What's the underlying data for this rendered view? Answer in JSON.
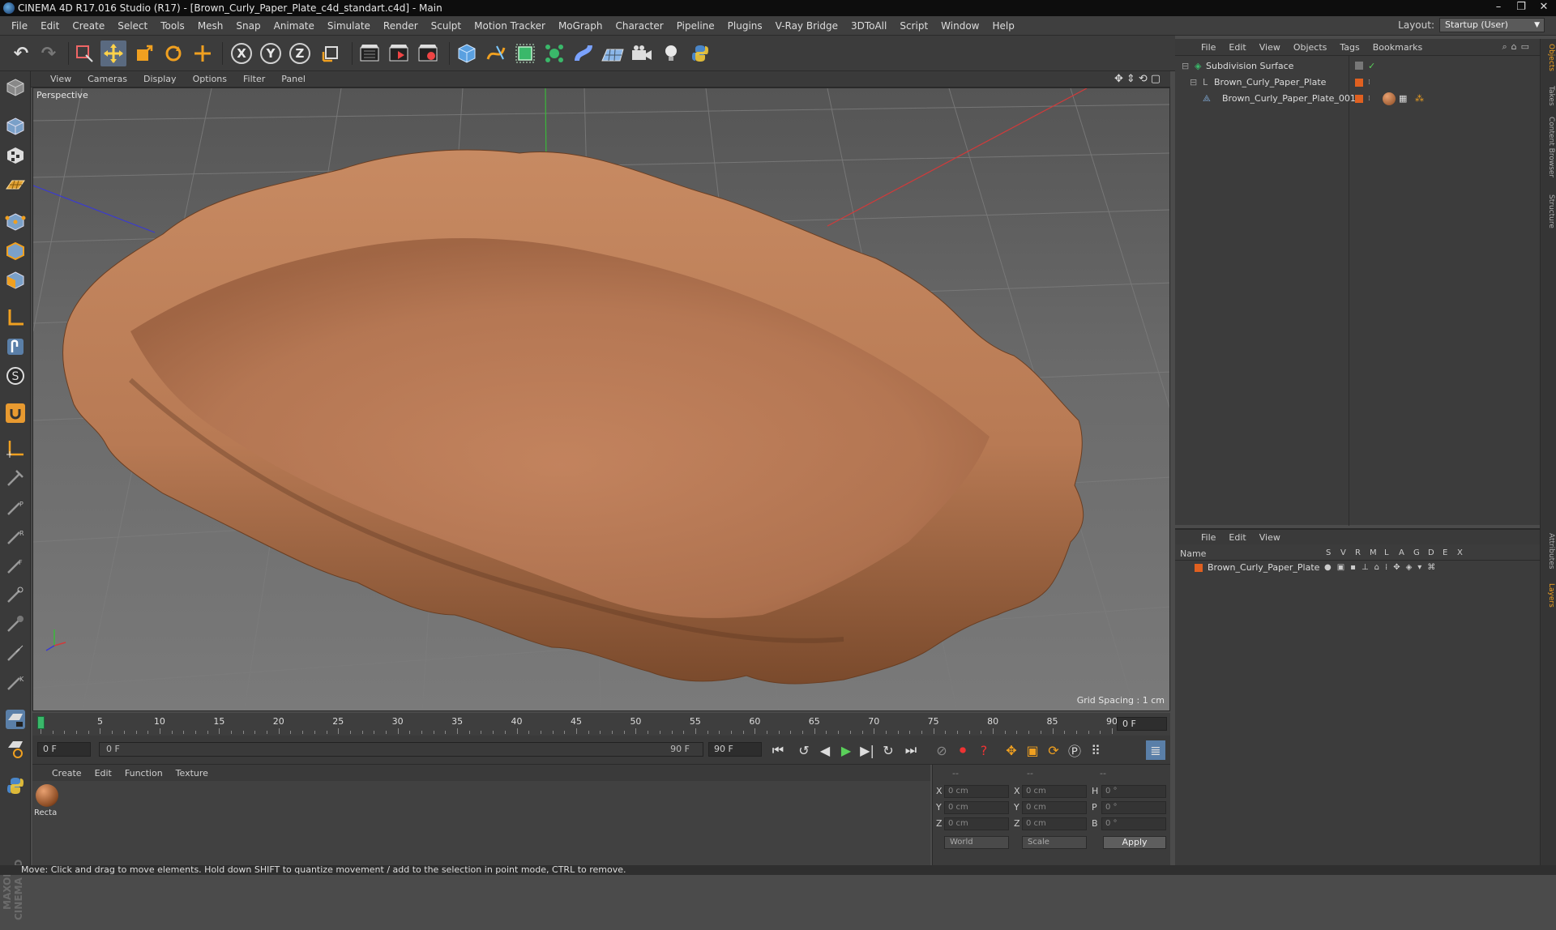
{
  "window": {
    "title": "CINEMA 4D R17.016 Studio (R17) - [Brown_Curly_Paper_Plate_c4d_standart.c4d] - Main",
    "controls": [
      "–",
      "❐",
      "✕"
    ]
  },
  "menubar": {
    "items": [
      "File",
      "Edit",
      "Create",
      "Select",
      "Tools",
      "Mesh",
      "Snap",
      "Animate",
      "Simulate",
      "Render",
      "Sculpt",
      "Motion Tracker",
      "MoGraph",
      "Character",
      "Pipeline",
      "Plugins",
      "V-Ray Bridge",
      "3DToAll",
      "Script",
      "Window",
      "Help"
    ],
    "layout_label": "Layout:",
    "layout_value": "Startup (User)"
  },
  "toolbar": {
    "axis_x": "X",
    "axis_y": "Y",
    "axis_z": "Z"
  },
  "viewport": {
    "menu": [
      "View",
      "Cameras",
      "Display",
      "Options",
      "Filter",
      "Panel"
    ],
    "camera_label": "Perspective",
    "grid_spacing": "Grid Spacing : 1 cm",
    "colors": {
      "x_axis": "#d23a3a",
      "y_axis": "#3ab83a",
      "z_axis": "#3a3ad2",
      "plate": "#c68a62"
    }
  },
  "timeline": {
    "ticks": [
      "0",
      "5",
      "10",
      "15",
      "20",
      "25",
      "30",
      "35",
      "40",
      "45",
      "50",
      "55",
      "60",
      "65",
      "70",
      "75",
      "80",
      "85",
      "90"
    ],
    "current_frame": "0 F"
  },
  "transport": {
    "start_frame": "0 F",
    "range_start": "0 F",
    "range_end": "90 F",
    "end_frame": "90 F"
  },
  "material_manager": {
    "menu": [
      "Create",
      "Edit",
      "Function",
      "Texture"
    ],
    "material_name": "Recta"
  },
  "coordinates": {
    "headers": [
      "--",
      "--",
      "--"
    ],
    "pos_labels": [
      "X",
      "Y",
      "Z"
    ],
    "size_labels": [
      "X",
      "Y",
      "Z"
    ],
    "rot_labels": [
      "H",
      "P",
      "B"
    ],
    "pos_values": [
      "0 cm",
      "0 cm",
      "0 cm"
    ],
    "size_values": [
      "0 cm",
      "0 cm",
      "0 cm"
    ],
    "rot_values": [
      "0 °",
      "0 °",
      "0 °"
    ],
    "space_mode": "World",
    "size_mode": "Scale",
    "apply_label": "Apply"
  },
  "objects_panel": {
    "menu": [
      "File",
      "Edit",
      "View",
      "Objects",
      "Tags",
      "Bookmarks"
    ],
    "rows": [
      {
        "name": "Subdivision Surface"
      },
      {
        "name": "Brown_Curly_Paper_Plate"
      },
      {
        "name": "Brown_Curly_Paper_Plate_001"
      }
    ]
  },
  "layers_panel": {
    "menu": [
      "File",
      "Edit",
      "View"
    ],
    "name_header": "Name",
    "column_headers": [
      "S",
      "V",
      "R",
      "M",
      "L",
      "A",
      "G",
      "D",
      "E",
      "X"
    ],
    "rows": [
      {
        "name": "Brown_Curly_Paper_Plate"
      }
    ]
  },
  "side_tabs": [
    "Objects",
    "Takes",
    "Content Browser",
    "Structure",
    "Attributes",
    "Layers"
  ],
  "status": {
    "text": "Move: Click and drag to move elements. Hold down SHIFT to quantize movement / add to the selection in point mode, CTRL to remove."
  },
  "branding": {
    "vertical_text": "MAXON CINEMA 4D"
  }
}
